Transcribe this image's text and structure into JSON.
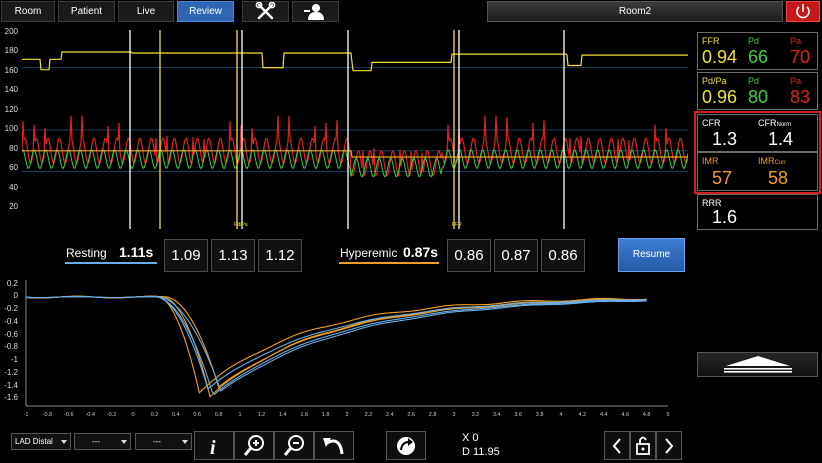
{
  "tabs": [
    {
      "label": "Room"
    },
    {
      "label": "Patient"
    },
    {
      "label": "Live"
    },
    {
      "label": "Review",
      "active": true
    }
  ],
  "room_label": "Room2",
  "colors": {
    "accent": "#2f66b3",
    "yellow": "#f2e230",
    "green": "#3ecf3e",
    "red": "#e02020",
    "orange": "#f0a020",
    "blue": "#6aaee8",
    "power": "#c51818"
  },
  "upper_chart": {
    "y_ticks": [
      "200",
      "180",
      "160",
      "140",
      "120",
      "100",
      "80",
      "60",
      "40",
      "20"
    ],
    "markers": [
      "Pd/Pa",
      "FFR"
    ]
  },
  "resting": {
    "label": "Resting",
    "value": "1.11s",
    "values": [
      "1.09",
      "1.13",
      "1.12"
    ]
  },
  "hyperemic": {
    "label": "Hyperemic",
    "value": "0.87s",
    "values": [
      "0.86",
      "0.87",
      "0.86"
    ]
  },
  "resume_label": "Resume",
  "panel": {
    "ffr": {
      "label": "FFR",
      "value": "0.94"
    },
    "pd1": {
      "label": "Pd",
      "value": "66"
    },
    "pa1": {
      "label": "Pa",
      "value": "70"
    },
    "pdpa": {
      "label": "Pd/Pa",
      "value": "0.96"
    },
    "pd2": {
      "label": "Pd",
      "value": "80"
    },
    "pa2": {
      "label": "Pa",
      "value": "83"
    },
    "cfr": {
      "label": "CFR",
      "value": "1.3"
    },
    "cfrnorm": {
      "label": "CFR",
      "sub": "Norm",
      "value": "1.4"
    },
    "imr": {
      "label": "IMR",
      "value": "57"
    },
    "imrcorr": {
      "label": "IMR",
      "sub": "Corr",
      "value": "58"
    },
    "rrr": {
      "label": "RRR",
      "value": "1.6"
    }
  },
  "lower_chart": {
    "y_ticks": [
      "0.2",
      "0",
      "-0.2",
      "-0.4",
      "-0.6",
      "-0.8",
      "-1",
      "-1.2",
      "-1.4",
      "-1.6"
    ],
    "x_ticks": [
      "-1",
      "-0.8",
      "-0.6",
      "-0.4",
      "-0.2",
      "0",
      "0.2",
      "0.4",
      "0.6",
      "0.8",
      "1",
      "1.2",
      "1.4",
      "1.6",
      "1.8",
      "2",
      "2.2",
      "2.4",
      "2.6",
      "2.8",
      "3",
      "3.2",
      "3.4",
      "3.6",
      "3.8",
      "4",
      "4.2",
      "4.4",
      "4.6",
      "4.8",
      "5"
    ]
  },
  "bottom": {
    "location": "LAD Distal",
    "dd2": "---",
    "dd3": "---",
    "x_readout": "X 0",
    "d_readout": "D 11.95"
  }
}
